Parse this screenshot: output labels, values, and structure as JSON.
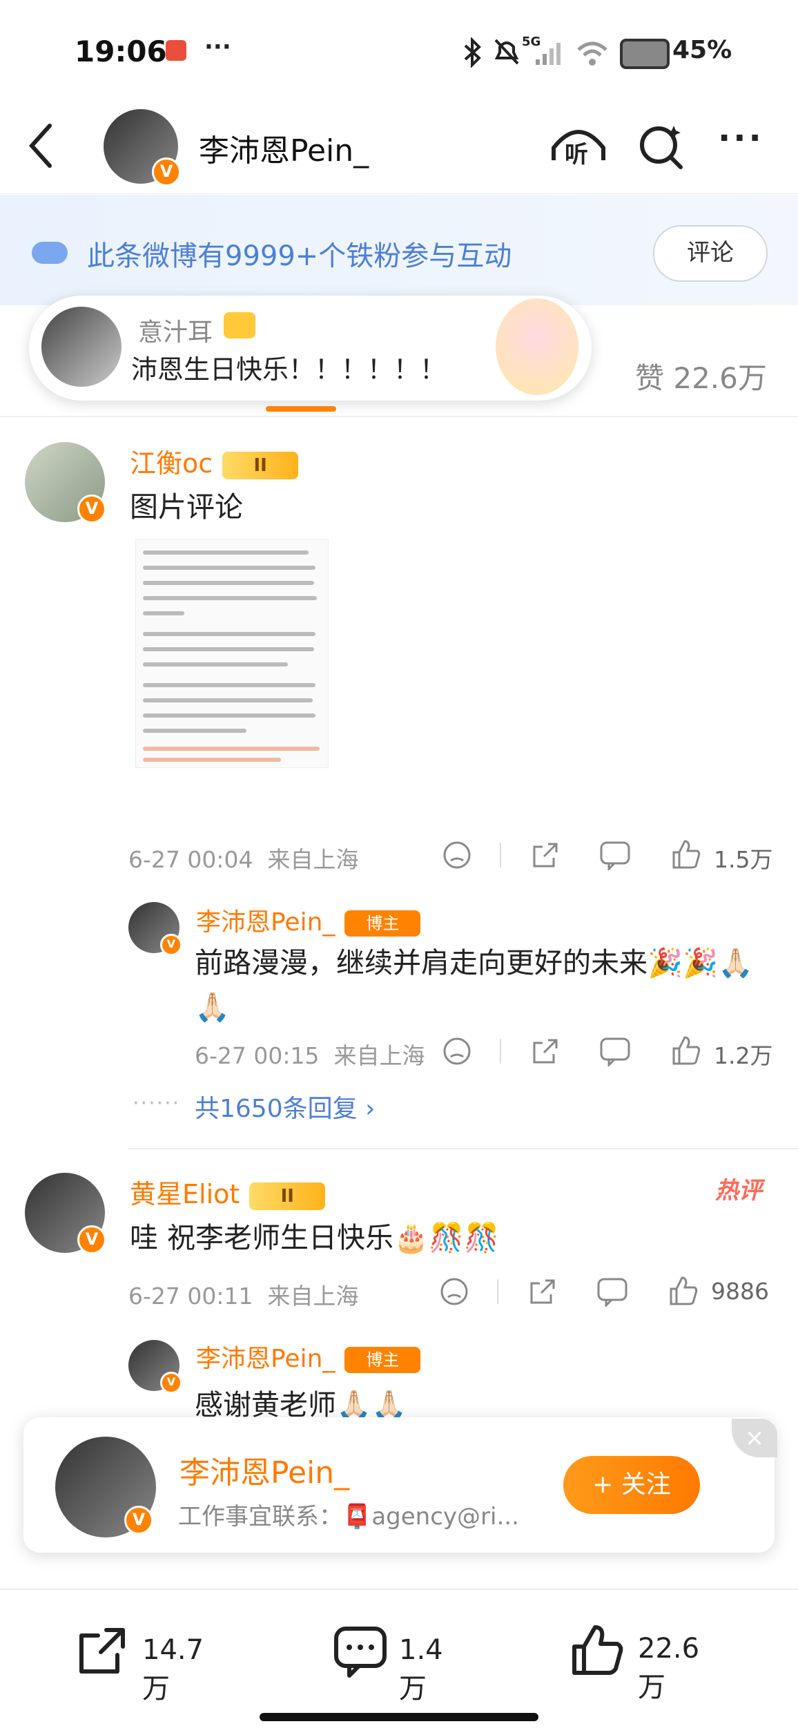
{
  "status_bar": {
    "time": "19:06",
    "battery": "45%",
    "network": "5G",
    "icons": [
      "wechat-icon",
      "more-icon",
      "bluetooth-icon",
      "mute-icon",
      "signal-icon",
      "wifi-icon",
      "battery-icon"
    ]
  },
  "header": {
    "title": "李沛恩Pein_",
    "icons": [
      "back-icon",
      "listen-icon",
      "search-icon",
      "more-icon"
    ],
    "listen_label": "听"
  },
  "banner": {
    "text": "此条微博有9999+个铁粉参与互动",
    "button": "评论"
  },
  "popup": {
    "name": "意汁耳",
    "text": "沛恩生日快乐！！！！！！"
  },
  "like_total": "赞 22.6万",
  "comments": [
    {
      "name": "江衡oc",
      "level": "II",
      "text": "图片评论",
      "date": "6-27 00:04",
      "location": "来自上海",
      "likes": "1.5万",
      "reply": {
        "name": "李沛恩Pein_",
        "badge": "博主",
        "text": "前路漫漫，继续并肩走向更好的未来🎉🎉🙏🏻🙏🏻",
        "date": "6-27 00:15",
        "location": "来自上海",
        "likes": "1.2万"
      },
      "more_replies": "共1650条回复"
    },
    {
      "name": "黄星Eliot",
      "level": "II",
      "text": "哇 祝李老师生日快乐🎂🎊🎊",
      "date": "6-27 00:11",
      "location": "来自上海",
      "likes": "9886",
      "hot": "热评",
      "reply": {
        "name": "李沛恩Pein_",
        "badge": "博主",
        "text": "感谢黄老师🙏🏻🙏🏻"
      }
    }
  ],
  "follow_card": {
    "name": "李沛恩Pein_",
    "desc": "工作事宜联系：📮agency@ri...",
    "button": "+ 关注",
    "close": "×"
  },
  "bottom_bar": {
    "share": "14.7万",
    "comment": "1.4万",
    "like": "22.6万"
  }
}
